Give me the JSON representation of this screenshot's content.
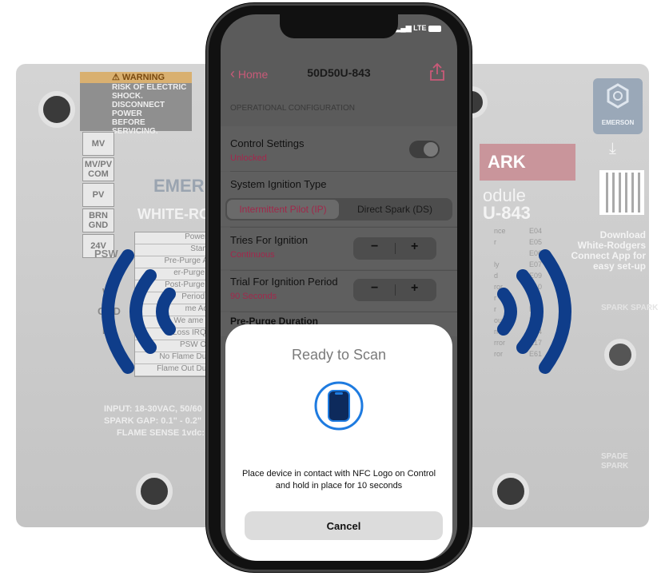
{
  "background": {
    "left_board": {
      "warning_title": "WARNING",
      "warning_lines": [
        "RISK OF ELECTRIC",
        "SHOCK.",
        "DISCONNECT POWER",
        "BEFORE SERVICING."
      ],
      "terminals": [
        "MV",
        "MV/PV COM",
        "PV",
        "BRN GND",
        "24V"
      ],
      "brand_top": "EMER",
      "brand_bottom": "WHITE-RO",
      "status_rows": [
        "Power Up",
        "Standby",
        "Pre-Purge Activ",
        "er-Purge Acti",
        "Post-Purge Acti",
        "Period Acti",
        "me Active",
        "We ame Sen",
        "Loss IRQ Sig",
        "PSW Open",
        "No Flame During",
        "Flame Out During"
      ],
      "side_labels": [
        "PSW",
        "W",
        "GND",
        "R"
      ],
      "specs": [
        "INPUT: 18-30VAC, 50/60",
        "SPARK GAP: 0.1\" - 0.2\"",
        "FLAME SENSE 1vdc:"
      ]
    },
    "right_board": {
      "red_label": "ARK",
      "model_lines": [
        "odule",
        "U-843"
      ],
      "code_rows": [
        {
          "left": "nce",
          "right": "E04"
        },
        {
          "left": "r",
          "right": "E05"
        },
        {
          "left": "",
          "right": "E06"
        },
        {
          "left": "ly",
          "right": "E07"
        },
        {
          "left": "d",
          "right": "E09"
        },
        {
          "left": "ror",
          "right": "E10"
        },
        {
          "left": "r",
          "right": "E11"
        },
        {
          "left": "r",
          "right": "E12"
        },
        {
          "left": "out",
          "right": "E13"
        },
        {
          "left": "rror",
          "right": "E14"
        },
        {
          "left": "rror",
          "right": "E17"
        },
        {
          "left": "ror",
          "right": "E61"
        }
      ],
      "emerson_label": "EMERSON",
      "download_text": [
        "Download",
        "White-Rodgers",
        "Connect App for",
        "easy set-up"
      ],
      "terminal_labels": [
        "SPARK SPARK",
        "SPADE",
        "SPARK"
      ]
    }
  },
  "phone": {
    "status": {
      "network": "LTE"
    },
    "nav": {
      "back_label": "Home",
      "title": "50D50U-843"
    },
    "section_header": "OPERATIONAL CONFIGURATION",
    "control_settings": {
      "label": "Control Settings",
      "value": "Unlocked"
    },
    "ignition_type": {
      "label": "System Ignition Type",
      "options": [
        "Intermittent Pilot (IP)",
        "Direct Spark (DS)"
      ],
      "selected": "Intermittent Pilot (IP)"
    },
    "tries": {
      "label": "Tries For Ignition",
      "value": "Continuous"
    },
    "trial_period": {
      "label": "Trial For Ignition Period",
      "value": "90 Seconds"
    },
    "pre_purge": {
      "label": "Pre-Purge Duration"
    },
    "stepper": {
      "minus": "−",
      "plus": "+"
    },
    "sheet": {
      "title": "Ready to Scan",
      "message": "Place device in contact with NFC Logo on Control and hold in place for 10 seconds",
      "cancel_label": "Cancel"
    }
  },
  "colors": {
    "accent": "#a2284c",
    "nfc_wave": "#0f3d8a",
    "nfc_icon": "#1e7be0"
  }
}
